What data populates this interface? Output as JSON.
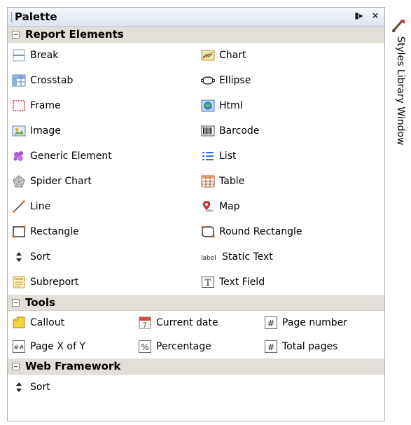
{
  "palette": {
    "title": "Palette",
    "sections": [
      {
        "name": "Report Elements",
        "items": [
          {
            "label": "Break",
            "icon": "break-icon"
          },
          {
            "label": "Chart",
            "icon": "chart-icon"
          },
          {
            "label": "Crosstab",
            "icon": "crosstab-icon"
          },
          {
            "label": "Ellipse",
            "icon": "ellipse-icon"
          },
          {
            "label": "Frame",
            "icon": "frame-icon"
          },
          {
            "label": "Html",
            "icon": "html-icon"
          },
          {
            "label": "Image",
            "icon": "image-icon"
          },
          {
            "label": "Barcode",
            "icon": "barcode-icon"
          },
          {
            "label": "Generic Element",
            "icon": "generic-element-icon"
          },
          {
            "label": "List",
            "icon": "list-icon"
          },
          {
            "label": "Spider Chart",
            "icon": "spider-chart-icon"
          },
          {
            "label": "Table",
            "icon": "table-icon"
          },
          {
            "label": "Line",
            "icon": "line-icon"
          },
          {
            "label": "Map",
            "icon": "map-icon"
          },
          {
            "label": "Rectangle",
            "icon": "rectangle-icon"
          },
          {
            "label": "Round Rectangle",
            "icon": "round-rectangle-icon"
          },
          {
            "label": "Sort",
            "icon": "sort-icon"
          },
          {
            "label": "Static Text",
            "icon": "static-text-icon",
            "icon_text": "label"
          },
          {
            "label": "Subreport",
            "icon": "subreport-icon"
          },
          {
            "label": "Text Field",
            "icon": "text-field-icon",
            "icon_text": "T"
          }
        ]
      },
      {
        "name": "Tools",
        "items": [
          {
            "label": "Callout",
            "icon": "callout-icon"
          },
          {
            "label": "Current date",
            "icon": "current-date-icon",
            "icon_text": "7"
          },
          {
            "label": "Page number",
            "icon": "page-number-icon",
            "icon_text": "#"
          },
          {
            "label": "Page X of Y",
            "icon": "page-x-of-y-icon",
            "icon_text": "##"
          },
          {
            "label": "Percentage",
            "icon": "percentage-icon",
            "icon_text": "%"
          },
          {
            "label": "Total pages",
            "icon": "total-pages-icon",
            "icon_text": "#"
          }
        ]
      },
      {
        "name": "Web Framework",
        "items": [
          {
            "label": "Sort",
            "icon": "sort-icon"
          }
        ]
      }
    ]
  },
  "side_window": {
    "label": "Styles Library Window",
    "icon": "brush-icon"
  }
}
